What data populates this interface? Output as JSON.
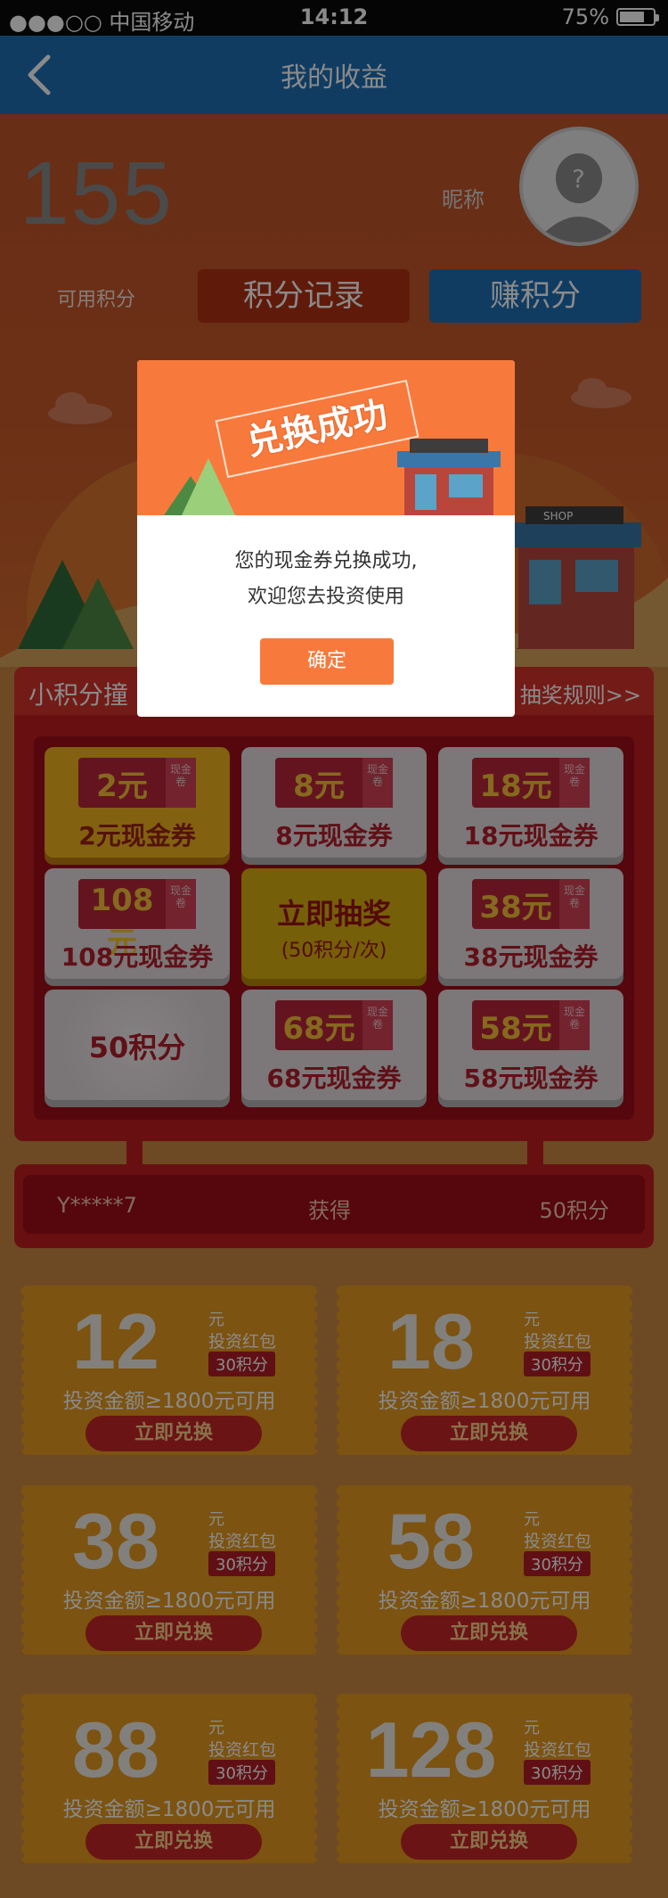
{
  "status_bar": {
    "carrier": "●●●○○ 中国移动",
    "time": "14:12",
    "battery": "75%",
    "battery_level": 0.75
  },
  "nav": {
    "title": "我的收益"
  },
  "profile": {
    "points": "155",
    "points_label": "可用积分",
    "nickname": "昵称",
    "record_button": "积分记录",
    "earn_button": "赚积分"
  },
  "lottery": {
    "title": "小积分撞",
    "rules_link": "抽奖规则>>",
    "ticket_side": "现金卷",
    "tiles": [
      {
        "amount": "2元",
        "label": "2元现金券"
      },
      {
        "amount": "8元",
        "label": "8元现金券"
      },
      {
        "amount": "18元",
        "label": "18元现金券"
      },
      {
        "amount": "108元",
        "label": "108元现金券"
      },
      {
        "draw": "立即抽奖",
        "cost": "(50积分/次)"
      },
      {
        "amount": "38元",
        "label": "38元现金券"
      },
      {
        "points": "50积分"
      },
      {
        "amount": "68元",
        "label": "68元现金券"
      },
      {
        "amount": "58元",
        "label": "58元现金券"
      }
    ]
  },
  "winner": {
    "user": "Y*****7",
    "action": "获得",
    "prize": "50积分"
  },
  "coupons": [
    {
      "amount": "12",
      "unit": "元",
      "type": "投资红包",
      "cost": "30积分",
      "condition": "投资金额≥1800元可用",
      "button": "立即兑换"
    },
    {
      "amount": "18",
      "unit": "元",
      "type": "投资红包",
      "cost": "30积分",
      "condition": "投资金额≥1800元可用",
      "button": "立即兑换"
    },
    {
      "amount": "38",
      "unit": "元",
      "type": "投资红包",
      "cost": "30积分",
      "condition": "投资金额≥1800元可用",
      "button": "立即兑换"
    },
    {
      "amount": "58",
      "unit": "元",
      "type": "投资红包",
      "cost": "30积分",
      "condition": "投资金额≥1800元可用",
      "button": "立即兑换"
    },
    {
      "amount": "88",
      "unit": "元",
      "type": "投资红包",
      "cost": "30积分",
      "condition": "投资金额≥1800元可用",
      "button": "立即兑换"
    },
    {
      "amount": "128",
      "unit": "元",
      "type": "投资红包",
      "cost": "30积分",
      "condition": "投资金额≥1800元可用",
      "button": "立即兑换"
    }
  ],
  "modal": {
    "stamp": "兑换成功",
    "shop_sign": "SHOP",
    "line1": "您的现金券兑换成功,",
    "line2": "欢迎您去投资使用",
    "confirm": "确定"
  },
  "colors": {
    "nav_blue": "#1f6fb6",
    "modal_orange": "#f77a3c",
    "board_red": "#c11e20"
  }
}
